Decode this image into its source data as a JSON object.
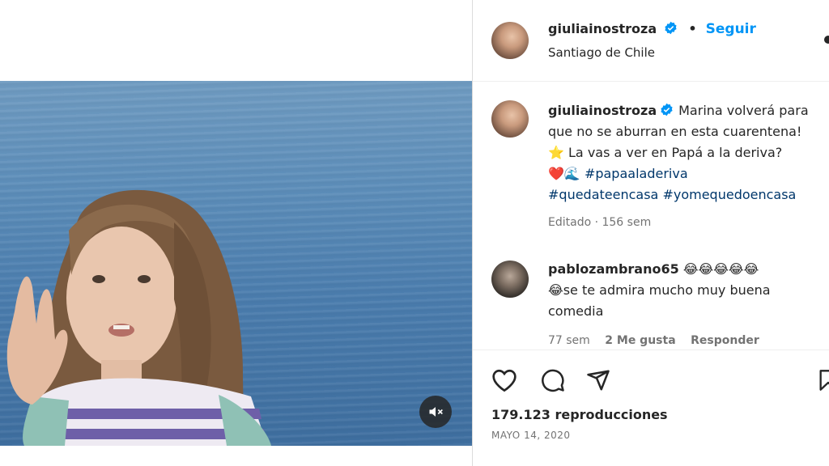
{
  "post": {
    "author": "giuliainostroza",
    "follow_label": "Seguir",
    "location": "Santiago de Chile",
    "separator": "•"
  },
  "caption": {
    "author": "giuliainostroza",
    "line1": "Marina volverá para",
    "line2": "que no se aburran en esta cuarentena!",
    "line3_emoji": "⭐",
    "line3_text": "La vas a ver en Papá a la deriva?",
    "line4_emojis": "❤️🌊",
    "hashtag1": "#papaaladeriva",
    "hashtag2": "#quedateencasa",
    "hashtag3": "#yomequedoencasa",
    "meta": "Editado · 156 sem"
  },
  "comment": {
    "author": "pablozambrano65",
    "emojis": "😂😂😂😂😂",
    "line2_emoji": "😂",
    "line2_text": "se te admira mucho muy buena",
    "line3_text": "comedia",
    "time": "77 sem",
    "likes": "2 Me gusta",
    "reply": "Responder"
  },
  "stats": {
    "views": "179.123 reproducciones",
    "date": "MAYO 14, 2020"
  },
  "icons": {
    "like": "heart-icon",
    "comment": "comment-icon",
    "share": "send-icon",
    "save": "bookmark-icon",
    "mute": "muted-speaker-icon",
    "verified": "verified-badge-icon"
  },
  "colors": {
    "accent": "#0095f6",
    "verified": "#0095f6",
    "hashtag": "#00376b",
    "muted_text": "#737373"
  }
}
